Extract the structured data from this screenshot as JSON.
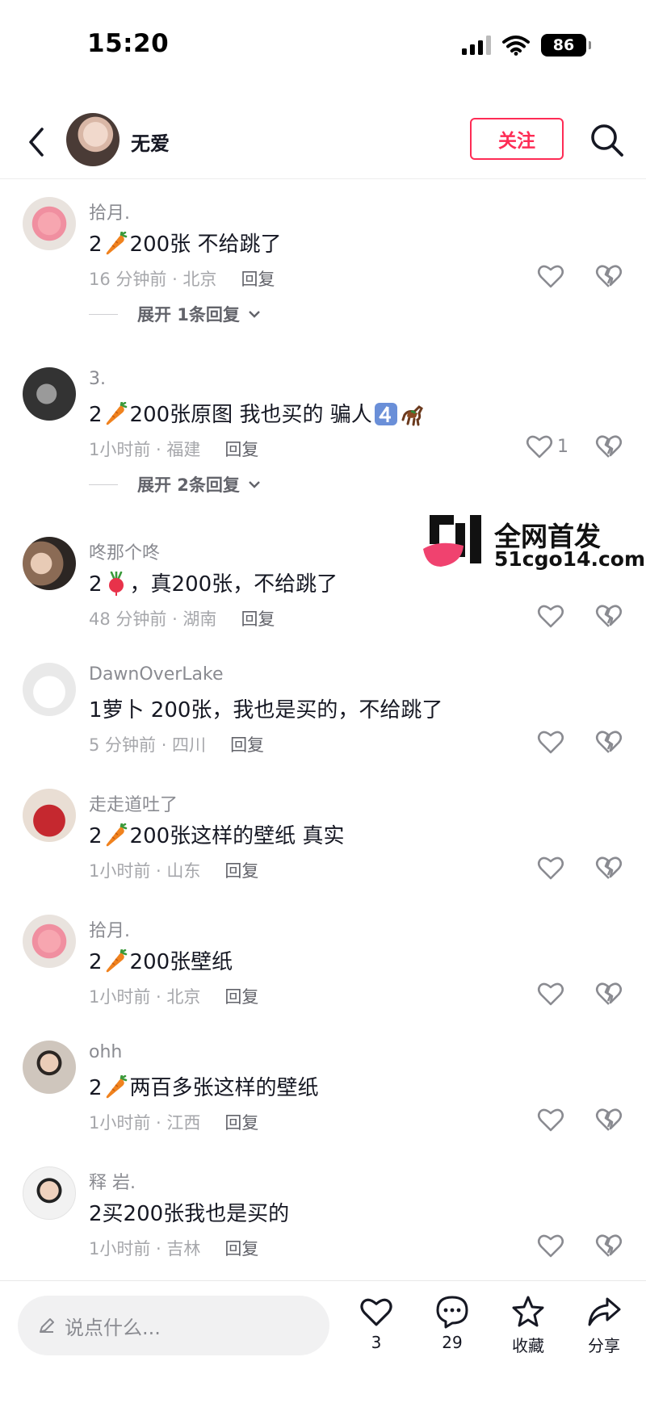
{
  "status_bar": {
    "time": "15:20",
    "battery": "86"
  },
  "header": {
    "username": "无爱",
    "follow_label": "关注"
  },
  "comments": [
    {
      "user": "拾月.",
      "before": "2",
      "after": "200张 不给跳了",
      "time": "16 分钟前 · 北京",
      "reply": "回复",
      "likes": "",
      "expand": "展开 1条回复"
    },
    {
      "user": "3.",
      "before": "2",
      "after": "200张原图 我也买的 骗人",
      "time": "1小时前 · 福建",
      "reply": "回复",
      "likes": "1",
      "expand": "展开 2条回复"
    },
    {
      "user": "咚那个咚",
      "before": "2",
      "after": "，真200张，不给跳了",
      "time": "48 分钟前 · 湖南",
      "reply": "回复",
      "likes": ""
    },
    {
      "user": "DawnOverLake",
      "text": "1萝卜  200张，我也是买的，不给跳了",
      "time": "5 分钟前 · 四川",
      "reply": "回复",
      "likes": ""
    },
    {
      "user": "走走道吐了",
      "before": "2",
      "after": "200张这样的壁纸 真实",
      "time": "1小时前 · 山东",
      "reply": "回复",
      "likes": ""
    },
    {
      "user": "拾月.",
      "before": "2",
      "after": "200张壁纸",
      "time": "1小时前 · 北京",
      "reply": "回复",
      "likes": ""
    },
    {
      "user": "ohh",
      "before": "2",
      "after": "两百多张这样的壁纸",
      "time": "1小时前 · 江西",
      "reply": "回复",
      "likes": ""
    },
    {
      "user": "释 岩.",
      "text": "2买200张我也是买的",
      "time": "1小时前 · 吉林",
      "reply": "回复",
      "likes": ""
    }
  ],
  "watermark": {
    "title": "全网首发",
    "url": "51cgo14.com"
  },
  "bottom_bar": {
    "input_placeholder": "说点什么...",
    "like_count": "3",
    "comment_count": "29",
    "favorite_label": "收藏",
    "share_label": "分享"
  },
  "colors": {
    "accent": "#fe2c55",
    "text": "#161823",
    "muted": "#8a8b91"
  },
  "icons": [
    "back-arrow-icon",
    "search-icon",
    "heart-icon",
    "broken-heart-icon",
    "carrot-emoji",
    "radish-emoji",
    "keycap-4-emoji",
    "horse-emoji",
    "pencil-icon",
    "comment-icon",
    "star-icon",
    "share-icon"
  ]
}
